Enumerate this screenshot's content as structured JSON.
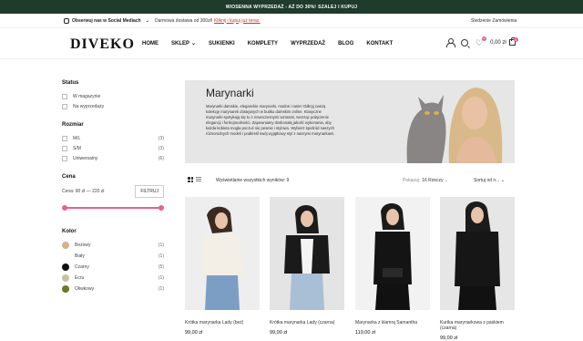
{
  "topbar": {
    "text": "WIOSENNA WYPRZEDAŻ - AŻ DO 30%!",
    "cta": "SZALEJ I KUPUJ"
  },
  "infobar": {
    "social": "Obserwuj nas w Social Mediach",
    "shipping": "Darmowa dostawa od 300zł!",
    "shipping_link": "Kliknij i kupuj już teraz.",
    "track": "Śledzenie Zamówienia"
  },
  "header": {
    "logo": "DIVEKO",
    "nav": [
      "HOME",
      "SKLEP",
      "SUKIENKI",
      "KOMPLETY",
      "WYPRZEDAŻ",
      "BLOG",
      "KONTAKT"
    ],
    "wishlist_count": "0",
    "cart_total": "0,00 zł",
    "cart_count": "0"
  },
  "sidebar": {
    "status_title": "Status",
    "status": [
      "W magazynie",
      "Na wyprzedaży"
    ],
    "size_title": "Rozmiar",
    "sizes": [
      {
        "label": "M/L",
        "count": "(3)"
      },
      {
        "label": "S/M",
        "count": "(3)"
      },
      {
        "label": "Uniwersalny",
        "count": "(6)"
      }
    ],
    "price_title": "Cena",
    "price_label": "Cena:",
    "price_range": "90 zł — 220 zł",
    "filter_button": "FILTRUJ",
    "color_title": "Kolor",
    "colors": [
      {
        "label": "Beżowy",
        "count": "(1)",
        "hex": "#d2b48c"
      },
      {
        "label": "Biały",
        "count": "(1)",
        "hex": "#ffffff"
      },
      {
        "label": "Czarny",
        "count": "(5)",
        "hex": "#111111"
      },
      {
        "label": "Ecru",
        "count": "(1)",
        "hex": "#c8c0a8"
      },
      {
        "label": "Oliwkowy",
        "count": "(1)",
        "hex": "#6b7a1f"
      }
    ]
  },
  "banner": {
    "title": "Marynarki",
    "text": "Marynarki damskie, eleganckie marynarki, modne i tanie! Odkryj naszą kolekcję marynarek dostępnych w butiku damskim online. Klasyczne marynarki spotykają się tu z nowoczesnymi wzorami, tworząc połączenie elegancji i funkcjonalności. Zapewniamy doskonałą jakość wykonania, aby każda kobieta mogła poczuć się pewnie i stylowo. Wybierz spośród naszych różnorodnych modeli i podkreśl swój wyjątkowy styl z naszymi marynarkami."
  },
  "toolbar": {
    "results": "Wyświetlanie wszystkich wyników: 9",
    "per_page_label": "Pokazuj:",
    "per_page_value": "16 Rzeczy",
    "sort": "Sortuj od n..."
  },
  "products": [
    {
      "name": "Krótka marynarka Lady (beż)",
      "price": "99,00 zł"
    },
    {
      "name": "Krótka marynarka Lady (czarna)",
      "price": "99,00 zł"
    },
    {
      "name": "Marynarka z klamrą Samantha",
      "price": "119,00 zł"
    },
    {
      "name": "Kurtka marynarkowa z paskiem (czarna)",
      "price": "99,00 zł"
    }
  ]
}
